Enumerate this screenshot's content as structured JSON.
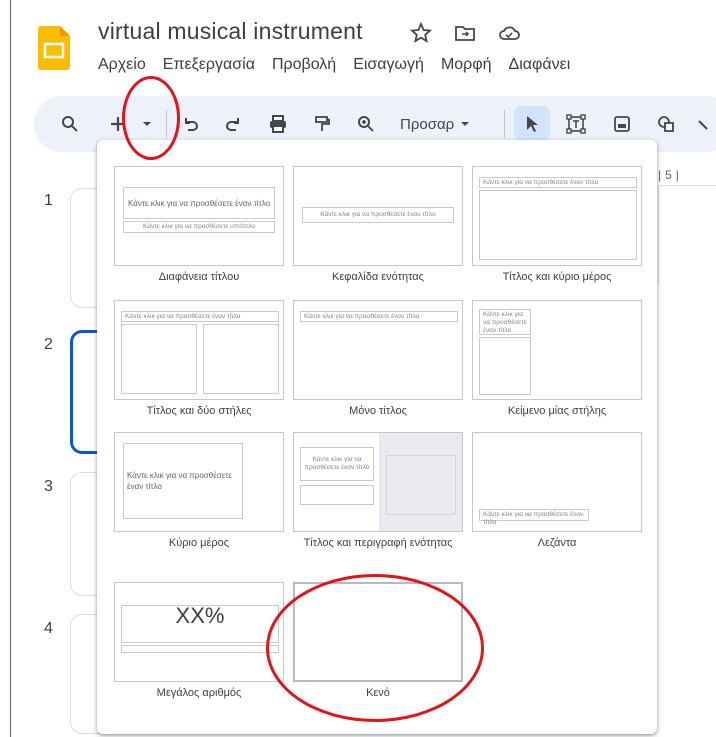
{
  "document": {
    "title": "virtual musical instrument"
  },
  "menubar": {
    "items": [
      "Αρχείο",
      "Επεξεργασία",
      "Προβολή",
      "Εισαγωγή",
      "Μορφή",
      "Διαφάνει"
    ]
  },
  "toolbar": {
    "zoom_label": "Προσαρ"
  },
  "filmstrip": {
    "slide_numbers": [
      "1",
      "2",
      "3",
      "4"
    ]
  },
  "ruler": {
    "marks": "|5|"
  },
  "layout_menu": {
    "options": [
      {
        "label": "Διαφάνεια τίτλου",
        "placeholder_title": "Κάντε κλικ για να προσθέσετε έναν τίτλο",
        "placeholder_sub": "Κάντε κλικ για να προσθέσετε υπότιτλο"
      },
      {
        "label": "Κεφαλίδα ενότητας",
        "placeholder_title": "Κάντε κλικ για να προσθέσετε έναν τίτλο"
      },
      {
        "label": "Τίτλος και κύριο μέρος",
        "placeholder_title": "Κάντε κλικ για να προσθέσετε έναν τίτλο"
      },
      {
        "label": "Τίτλος και δύο στήλες",
        "placeholder_title": "Κάντε κλικ για να προσθέσετε έναν τίτλο"
      },
      {
        "label": "Μόνο τίτλος",
        "placeholder_title": "Κάντε κλικ για να προσθέσετε έναν τίτλο"
      },
      {
        "label": "Κείμενο μίας στήλης",
        "placeholder_title": "Κάντε κλικ για να προσθέσετε έναν τίτλο"
      },
      {
        "label": "Κύριο μέρος",
        "placeholder_title": "Κάντε κλικ για να προσθέσετε έναν τίτλο"
      },
      {
        "label": "Τίτλος και περιγραφή ενότητας",
        "placeholder_title": "Κάντε κλικ για να προσθέσετε έναν τίτλο"
      },
      {
        "label": "Λεζάντα",
        "placeholder_title": "Κάντε κλικ για να προσθέσετε έναν τίτλο"
      },
      {
        "label": "Μεγάλος αριθμός",
        "big_number": "XX%"
      },
      {
        "label": "Κενό"
      }
    ]
  },
  "colors": {
    "accent": "#0b57d0",
    "toolbar_bg": "#edf2fa",
    "annotation": "#e2131a",
    "logo": "#fbbc04"
  }
}
